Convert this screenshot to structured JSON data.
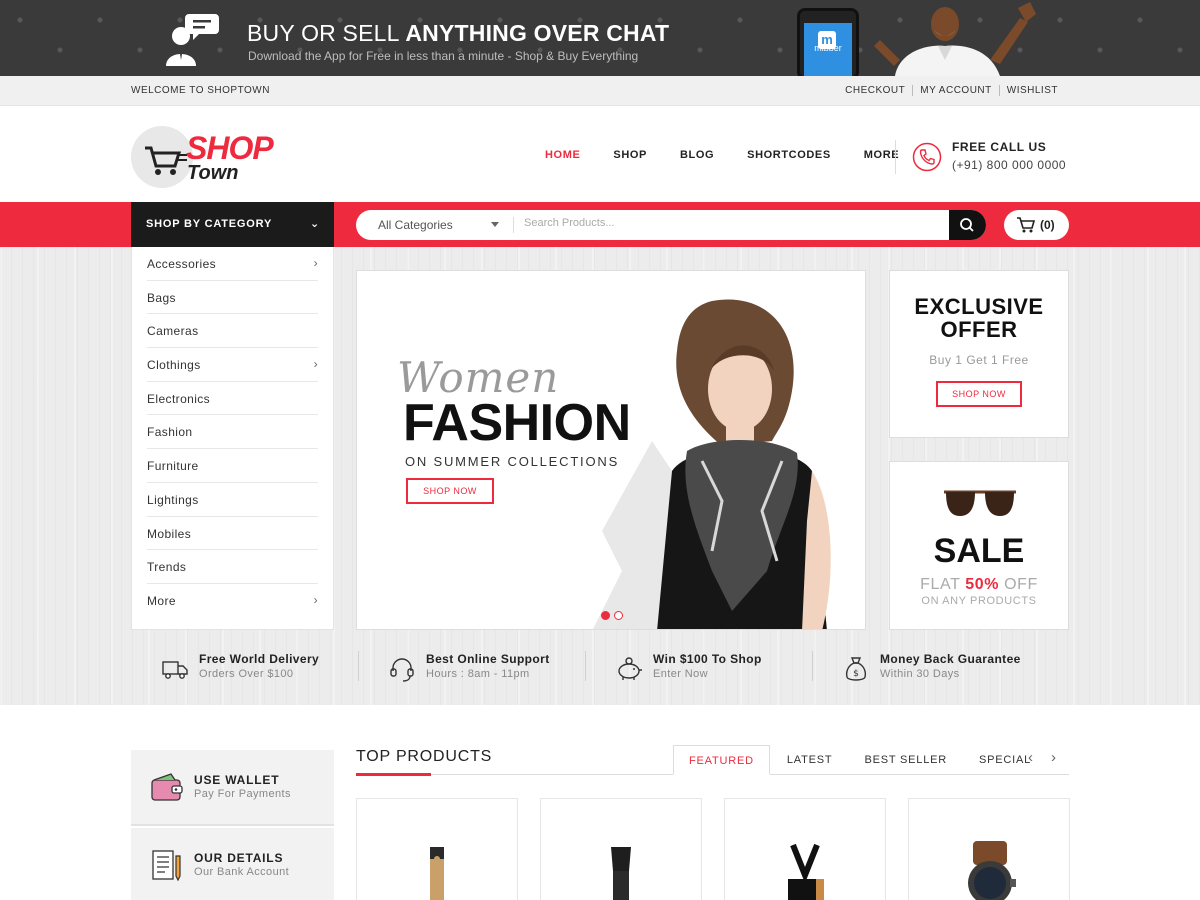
{
  "promo": {
    "title_light": "BUY OR SELL ",
    "title_bold": "ANYTHING OVER CHAT",
    "subtitle": "Download the App for Free in less than a minute - Shop & Buy Everything",
    "app_name": "mibber"
  },
  "topbar": {
    "welcome": "WELCOME TO SHOPTOWN",
    "links": [
      "CHECKOUT",
      "MY ACCOUNT",
      "WISHLIST"
    ]
  },
  "header": {
    "logo_shop": "SHOP",
    "logo_town": "Town",
    "nav": [
      "HOME",
      "SHOP",
      "BLOG",
      "SHORTCODES",
      "MORE"
    ],
    "call_title": "FREE CALL US",
    "call_number": "(+91) 800 000 0000"
  },
  "searchbar": {
    "category_button": "SHOP BY CATEGORY",
    "category_select": "All Categories",
    "placeholder": "Search Products...",
    "cart_count": "(0)"
  },
  "categories": [
    {
      "label": "Accessories",
      "submenu": true
    },
    {
      "label": "Bags",
      "submenu": false
    },
    {
      "label": "Cameras",
      "submenu": false
    },
    {
      "label": "Clothings",
      "submenu": true
    },
    {
      "label": "Electronics",
      "submenu": false
    },
    {
      "label": "Fashion",
      "submenu": false
    },
    {
      "label": "Furniture",
      "submenu": false
    },
    {
      "label": "Lightings",
      "submenu": false
    },
    {
      "label": "Mobiles",
      "submenu": false
    },
    {
      "label": "Trends",
      "submenu": false
    },
    {
      "label": "More",
      "submenu": true
    }
  ],
  "slider": {
    "script": "Women",
    "title": "FASHION",
    "subtitle": "ON SUMMER COLLECTIONS",
    "button": "SHOP NOW",
    "active_slide": 1,
    "slide_count": 2
  },
  "offer": {
    "title_line1": "EXCLUSIVE",
    "title_line2": "OFFER",
    "subtitle": "Buy 1 Get 1 Free",
    "button": "SHOP NOW"
  },
  "sale": {
    "title": "SALE",
    "flat_prefix": "FLAT ",
    "flat_value": "50%",
    "flat_suffix": " OFF",
    "note": "ON ANY PRODUCTS"
  },
  "features": [
    {
      "icon": "truck-icon",
      "title": "Free World Delivery",
      "subtitle": "Orders Over $100"
    },
    {
      "icon": "headset-icon",
      "title": "Best Online Support",
      "subtitle": "Hours : 8am - 11pm"
    },
    {
      "icon": "piggy-bank-icon",
      "title": "Win $100 To Shop",
      "subtitle": "Enter Now"
    },
    {
      "icon": "money-bag-icon",
      "title": "Money Back Guarantee",
      "subtitle": "Within 30 Days"
    }
  ],
  "sidebar_promos": [
    {
      "title": "USE WALLET",
      "subtitle": "Pay For Payments"
    },
    {
      "title": "OUR DETAILS",
      "subtitle": "Our Bank Account"
    }
  ],
  "top_products": {
    "title": "TOP PRODUCTS",
    "tabs": [
      "FEATURED",
      "LATEST",
      "BEST SELLER",
      "SPECIAL"
    ],
    "active_tab": 0
  },
  "colors": {
    "accent": "#ee2a3e",
    "dark": "#1b1b1b",
    "promo_bg": "#3a3a3a"
  }
}
